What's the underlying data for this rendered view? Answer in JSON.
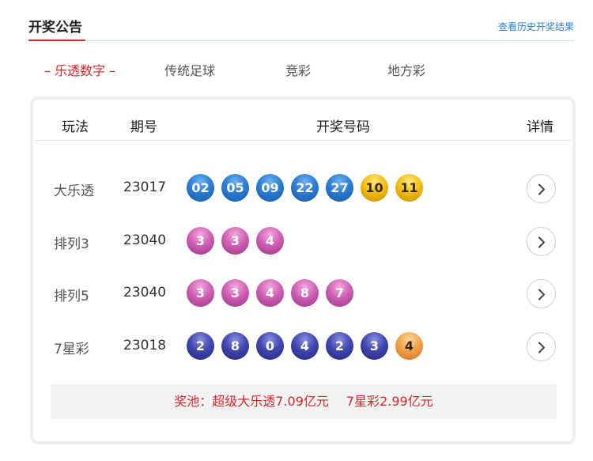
{
  "header": {
    "title": "开奖公告",
    "history_link": "查看历史开奖结果"
  },
  "tabs": [
    {
      "label": "– 乐透数字 –",
      "active": true
    },
    {
      "label": "传统足球",
      "active": false
    },
    {
      "label": "竞彩",
      "active": false
    },
    {
      "label": "地方彩",
      "active": false
    }
  ],
  "table": {
    "headers": {
      "play": "玩法",
      "issue": "期号",
      "numbers": "开奖号码",
      "detail": "详情"
    },
    "rows": [
      {
        "play": "大乐透",
        "issue": "23017",
        "balls": [
          "02",
          "05",
          "09",
          "22",
          "27",
          "10",
          "11"
        ],
        "colors": [
          "blue",
          "blue",
          "blue",
          "blue",
          "blue",
          "gold",
          "gold"
        ]
      },
      {
        "play": "排列3",
        "issue": "23040",
        "balls": [
          "3",
          "3",
          "4"
        ],
        "colors": [
          "pink",
          "pink",
          "pink"
        ]
      },
      {
        "play": "排列5",
        "issue": "23040",
        "balls": [
          "3",
          "3",
          "4",
          "8",
          "7"
        ],
        "colors": [
          "pink",
          "pink",
          "pink",
          "pink",
          "pink"
        ]
      },
      {
        "play": "7星彩",
        "issue": "23018",
        "balls": [
          "2",
          "8",
          "0",
          "4",
          "2",
          "3",
          "4"
        ],
        "colors": [
          "navy",
          "navy",
          "navy",
          "navy",
          "navy",
          "navy",
          "orange"
        ]
      }
    ]
  },
  "pool": {
    "label": "奖池：",
    "dlt": "超级大乐透7.09亿元",
    "qxc": "7星彩2.99亿元"
  },
  "colors": {
    "accent_red": "#e0242b",
    "link_blue": "#2a7fd4"
  },
  "icons": {
    "detail": "chevron-right-icon"
  }
}
